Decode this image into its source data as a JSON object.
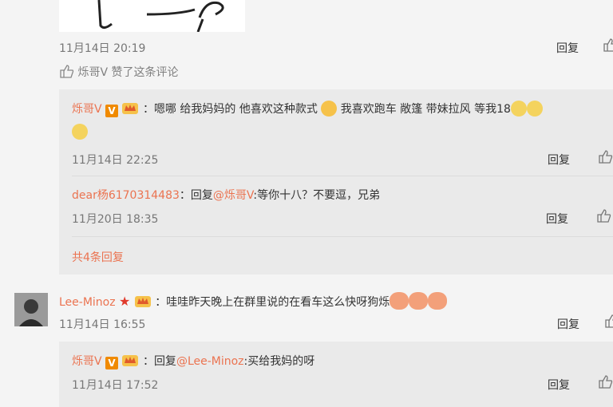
{
  "comment1": {
    "time": "11月14日 20:19",
    "reply_label": "回复",
    "liked_by": "烁哥V",
    "liked_text": "赞了这条评论"
  },
  "sub1": {
    "author": "烁哥V",
    "colon": "：",
    "text": "嗯哪 给我妈妈的 他喜欢这种款式",
    "text2": "我喜欢跑车 敞篷 带妹拉风 等我18",
    "time": "11月14日 22:25",
    "reply_label": "回复"
  },
  "sub2": {
    "author": "dear杨6170314483",
    "colon": "：",
    "reply_prefix": "回复",
    "mention": "@烁哥V",
    "text": ":等你十八？不要逗，兄弟",
    "time": "11月20日 18:35",
    "reply_label": "回复"
  },
  "more_replies": "共4条回复",
  "comment2": {
    "author": "Lee-Minoz",
    "colon": "：",
    "text": "哇哇昨天晚上在群里说的在看车这么快呀狗烁",
    "time": "11月14日 16:55",
    "reply_label": "回复"
  },
  "sub3": {
    "author": "烁哥V",
    "colon": "：",
    "reply_prefix": "回复",
    "mention": "@Lee-Minoz",
    "text": ":买给我妈的呀",
    "time": "11月14日 17:52",
    "reply_label": "回复"
  },
  "badges": {
    "v_letter": "V"
  },
  "colors": {
    "link": "#eb7350",
    "v_badge": "#f08a00",
    "star": "#e0392b"
  }
}
